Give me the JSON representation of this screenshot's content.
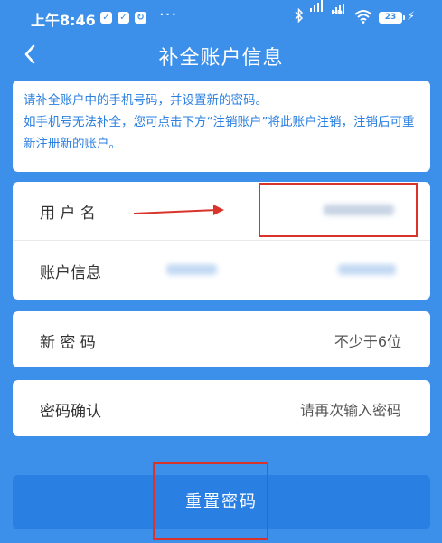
{
  "status_bar": {
    "time": "上午8:46",
    "more": "···",
    "hd_label": "HD",
    "battery": "23"
  },
  "header": {
    "title": "补全账户信息"
  },
  "notice": {
    "line1": "请补全账户中的手机号码，并设置新的密码。",
    "line2": "如手机号无法补全，您可点击下方“注销账户”将此账户注销，注销后可重新注册新的账户。"
  },
  "account": {
    "username_label": "用 户 名",
    "info_label": "账户信息"
  },
  "password": {
    "new_label": "新 密 码",
    "new_placeholder": "不少于6位",
    "confirm_label": "密码确认",
    "confirm_placeholder": "请再次输入密码"
  },
  "actions": {
    "reset_label": "重置密码"
  },
  "colors": {
    "background": "#3d90ea",
    "button": "#2a7fe3",
    "notice_text": "#2a7fe0",
    "annotation": "#d8342c"
  }
}
